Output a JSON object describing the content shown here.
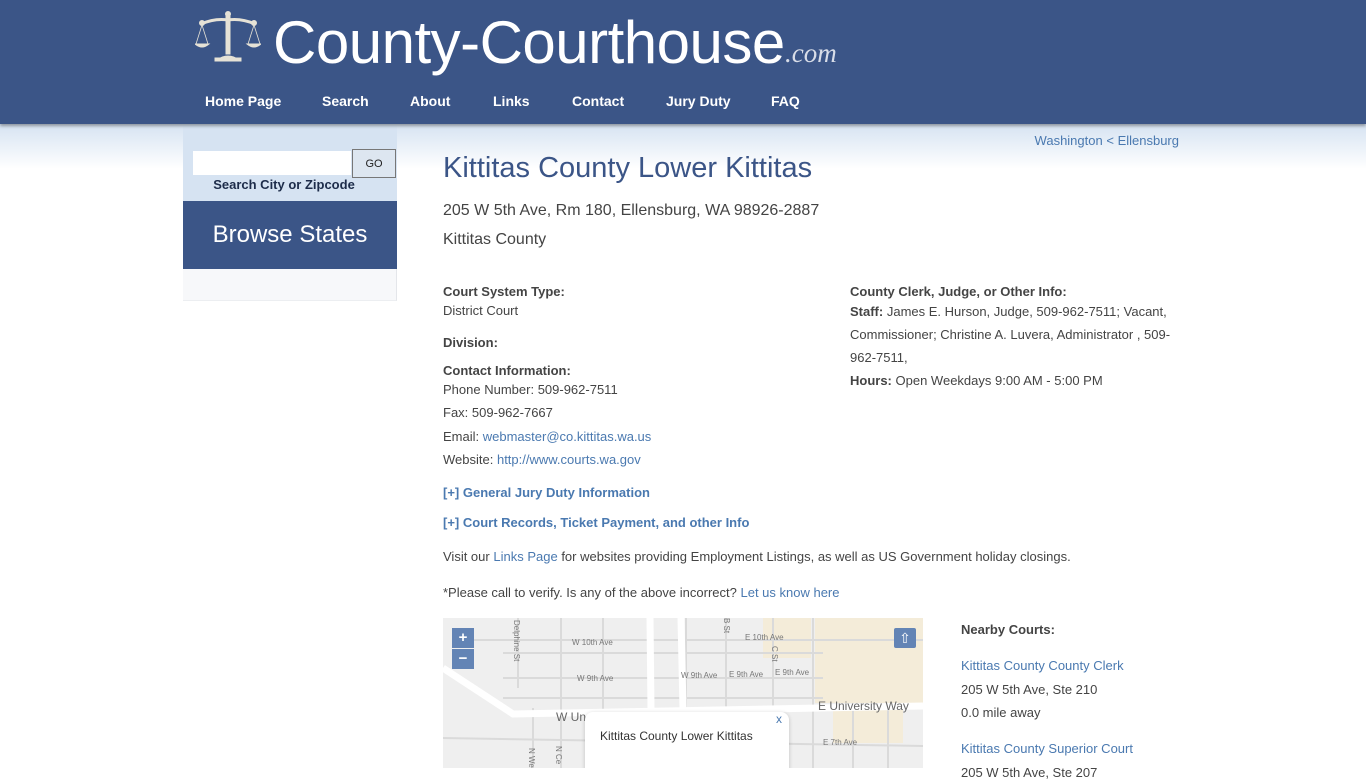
{
  "header": {
    "logo_icon": "scales-of-justice-icon",
    "logo_text": "County-Courthouse",
    "logo_suffix": ".com",
    "nav": [
      {
        "label": "Home Page"
      },
      {
        "label": "Search"
      },
      {
        "label": "About"
      },
      {
        "label": "Links"
      },
      {
        "label": "Contact"
      },
      {
        "label": "Jury Duty"
      },
      {
        "label": "FAQ"
      }
    ]
  },
  "sidebar": {
    "search_value": "",
    "search_placeholder": "",
    "go_label": "GO",
    "search_label": "Search City or Zipcode",
    "browse_label": "Browse States"
  },
  "breadcrumb": {
    "state": "Washington",
    "separator": "<",
    "city": "Ellensburg"
  },
  "court": {
    "title": "Kittitas County Lower Kittitas",
    "address": "205 W 5th Ave, Rm 180, Ellensburg, WA 98926-2887",
    "county": "Kittitas County",
    "system_type_label": "Court System Type:",
    "system_type": "District Court",
    "division_label": "Division:",
    "division": "",
    "contact_label": "Contact Information:",
    "phone_label": "Phone Number:",
    "phone": "509-962-7511",
    "fax_label": "Fax:",
    "fax": "509-962-7667",
    "email_label": "Email:",
    "email": "webmaster@co.kittitas.wa.us",
    "website_label": "Website:",
    "website": "http://www.courts.wa.gov",
    "other_label": "County Clerk, Judge, or Other Info:",
    "staff_label": "Staff:",
    "staff_line1": "James E. Hurson, Judge, 509-962-7511; Vacant,",
    "staff_line2": "Commissioner; Christine A. Luvera, Administrator , 509-",
    "staff_line3": "962-7511,",
    "hours_label": "Hours:",
    "hours": "Open Weekdays 9:00 AM - 5:00 PM"
  },
  "expanders": {
    "jury": "[+] General Jury Duty Information",
    "records": "[+] Court Records, Ticket Payment, and other Info"
  },
  "links_para": {
    "prefix": "Visit our",
    "link": "Links Page",
    "suffix": "for websites providing Employment Listings, as well as US Government holiday closings."
  },
  "verify_para": {
    "text": "*Please call to verify. Is any of the above incorrect?",
    "link": "Let us know here"
  },
  "map": {
    "zoom_in": "+",
    "zoom_out": "−",
    "recenter_icon": "up-arrow-icon",
    "popup_title": "Kittitas County Lower Kittitas",
    "popup_close": "x",
    "streets": {
      "w10": "W 10th Ave",
      "w9": "W 9th Ave",
      "w9b": "W 9th Ave",
      "e9a": "E 9th Ave",
      "e9b": "E 9th Ave",
      "e10": "E 10th Ave",
      "euniv": "E University Way",
      "wuniv": "W Un",
      "e7": "E 7th Ave",
      "delphine": "Delphine St",
      "cst": "C St",
      "bst": "B St",
      "ncedar": "N Ce",
      "nwe": "N We"
    }
  },
  "nearby": {
    "heading": "Nearby Courts:",
    "items": [
      {
        "name": "Kittitas County County Clerk",
        "address": "205 W 5th Ave, Ste 210",
        "distance": "0.0 mile away"
      },
      {
        "name": "Kittitas County Superior Court",
        "address": "205 W 5th Ave, Ste 207",
        "distance": ""
      }
    ]
  }
}
